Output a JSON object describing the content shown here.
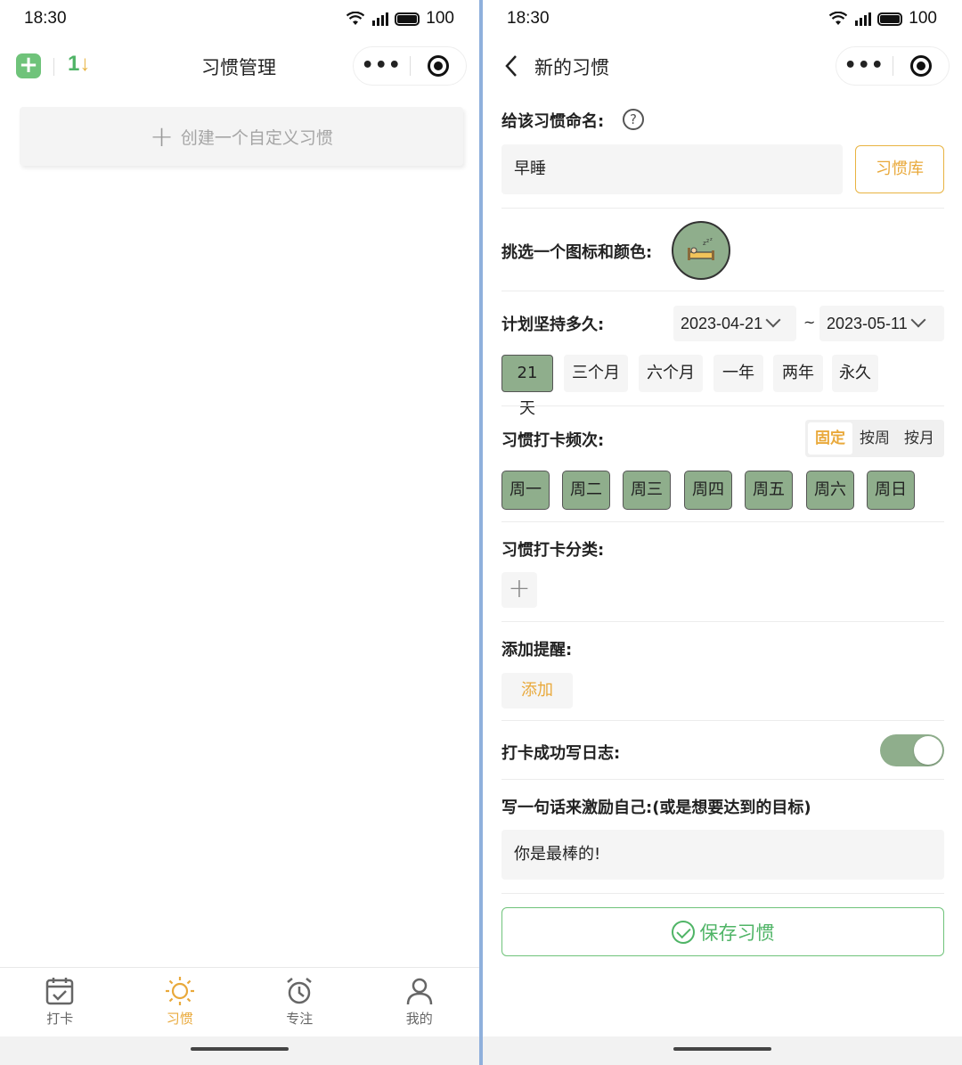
{
  "status_bar": {
    "time": "18:30",
    "battery": "100"
  },
  "left": {
    "logo_digit": "1",
    "title": "习惯管理",
    "create_label": "创建一个自定义习惯",
    "tabs": [
      {
        "label": "打卡",
        "icon": "calendar-check-icon",
        "active": false
      },
      {
        "label": "习惯",
        "icon": "sun-icon",
        "active": true
      },
      {
        "label": "专注",
        "icon": "alarm-clock-icon",
        "active": false
      },
      {
        "label": "我的",
        "icon": "person-icon",
        "active": false
      }
    ]
  },
  "right": {
    "title": "新的习惯",
    "name_label": "给该习惯命名:",
    "name_value": "早睡",
    "library_button": "习惯库",
    "icon_label": "挑选一个图标和颜色:",
    "icon_name": "sleeping-bed-icon",
    "duration_label": "计划坚持多久:",
    "start_date": "2023-04-21",
    "end_date": "2023-05-11",
    "separator": "~",
    "duration_options": [
      "21天",
      "三个月",
      "六个月",
      "一年",
      "两年",
      "永久"
    ],
    "duration_selected": "21天",
    "frequency_label": "习惯打卡频次:",
    "frequency_modes": [
      "固定",
      "按周",
      "按月"
    ],
    "frequency_mode_selected": "固定",
    "weekdays": [
      "周一",
      "周二",
      "周三",
      "周四",
      "周五",
      "周六",
      "周日"
    ],
    "category_label": "习惯打卡分类:",
    "reminder_label": "添加提醒:",
    "reminder_add": "添加",
    "journal_label": "打卡成功写日志:",
    "journal_enabled": true,
    "motto_label": "写一句话来激励自己:(或是想要达到的目标)",
    "motto_value": "你是最棒的!",
    "save_button": "保存习惯"
  },
  "colors": {
    "accent_orange": "#e9a93b",
    "selected_green": "#8fae8c",
    "save_green": "#4fb466"
  }
}
